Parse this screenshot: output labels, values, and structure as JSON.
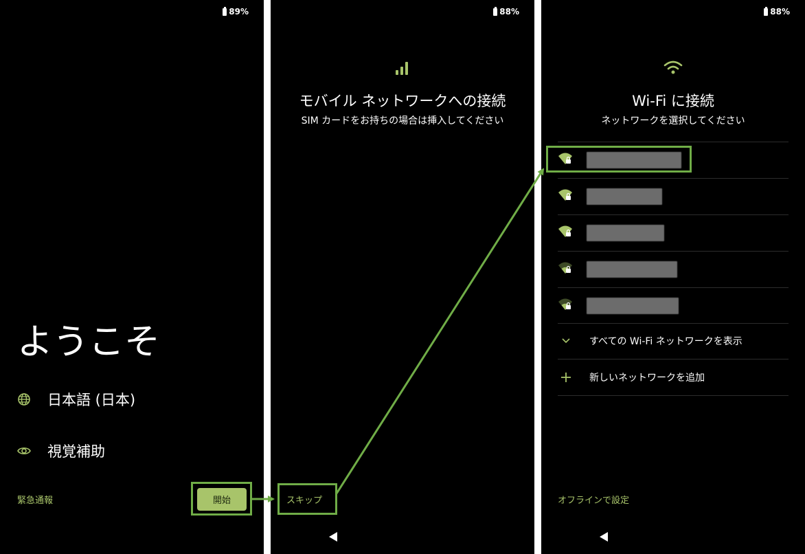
{
  "screen1": {
    "battery": "89%",
    "welcome_title": "ようこそ",
    "language_label": "日本語 (日本)",
    "accessibility_label": "視覚補助",
    "emergency_label": "緊急通報",
    "start_label": "開始"
  },
  "screen2": {
    "battery": "88%",
    "title": "モバイル ネットワークへの接続",
    "subtitle": "SIM カードをお持ちの場合は挿入してください",
    "skip_label": "スキップ"
  },
  "screen3": {
    "battery": "88%",
    "title": "Wi-Fi に接続",
    "subtitle": "ネットワークを選択してください",
    "networks": [
      {
        "name": "",
        "signal": "full"
      },
      {
        "name": "",
        "signal": "full"
      },
      {
        "name": "",
        "signal": "full"
      },
      {
        "name": "",
        "signal": "weak"
      },
      {
        "name": "",
        "signal": "weak"
      }
    ],
    "show_all_label": "すべての Wi-Fi ネットワークを表示",
    "add_network_label": "新しいネットワークを追加",
    "offline_label": "オフラインで設定"
  },
  "colors": {
    "accent": "#a8c46a",
    "highlight": "#70ad47",
    "background": "#000000"
  },
  "icons": [
    "battery-icon",
    "globe-icon",
    "eye-icon",
    "signal-icon",
    "wifi-icon",
    "wifi-lock-icon",
    "chevron-down-icon",
    "plus-icon",
    "back-icon"
  ]
}
